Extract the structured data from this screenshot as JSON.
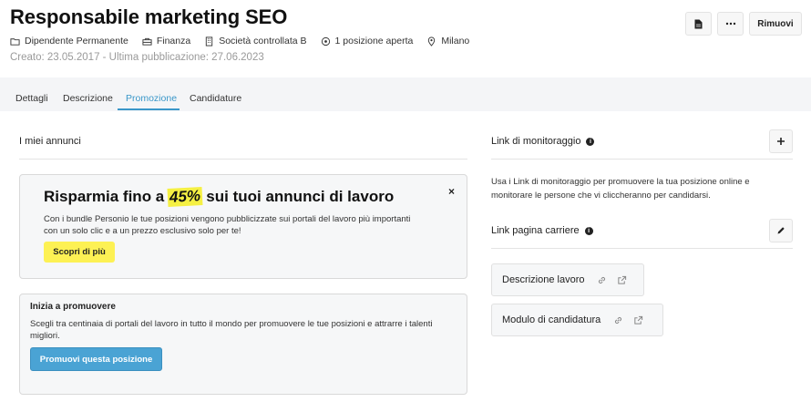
{
  "header": {
    "title": "Responsabile marketing SEO",
    "meta": [
      {
        "icon": "folder-icon",
        "label": "Dipendente Permanente"
      },
      {
        "icon": "briefcase-icon",
        "label": "Finanza"
      },
      {
        "icon": "building-icon",
        "label": "Società controllata B"
      },
      {
        "icon": "target-icon",
        "label": "1 posizione aperta"
      },
      {
        "icon": "location-pin-icon",
        "label": "Milano"
      }
    ],
    "dates": "Creato: 23.05.2017 - Ultima pubblicazione: 27.06.2023",
    "remove_label": "Rimuovi"
  },
  "tabs": [
    {
      "label": "Dettagli",
      "active": false
    },
    {
      "label": "Descrizione",
      "active": false
    },
    {
      "label": "Promozione",
      "active": true
    },
    {
      "label": "Candidature",
      "active": false
    }
  ],
  "left": {
    "section_title": "I miei annunci",
    "promo": {
      "title_before": "Risparmia fino a",
      "title_highlight": "45%",
      "title_after": "sui tuoi annunci di lavoro",
      "text": "Con i bundle Personio le tue posizioni vengono pubblicizzate sui portali del lavoro più importanti con un solo clic e a un prezzo esclusivo solo per te!",
      "button": "Scopri di più",
      "close": "×"
    },
    "start": {
      "title": "Inizia a promuovere",
      "text": "Scegli tra centinaia di portali del lavoro in tutto il mondo per promuovere le tue posizioni e attrarre i talenti migliori.",
      "button": "Promuovi questa posizione"
    }
  },
  "right": {
    "tracking_title": "Link di monitoraggio",
    "tracking_desc": "Usa i Link di monitoraggio per promuovere la tua posizione online e monitorare le persone che vi cliccheranno per candidarsi.",
    "career_title": "Link pagina carriere",
    "chips": [
      {
        "label": "Descrizione lavoro"
      },
      {
        "label": "Modulo di candidatura"
      }
    ]
  },
  "colors": {
    "accent": "#3a97c9",
    "highlight": "#fdf154",
    "primary_button": "#4aa3d4"
  }
}
